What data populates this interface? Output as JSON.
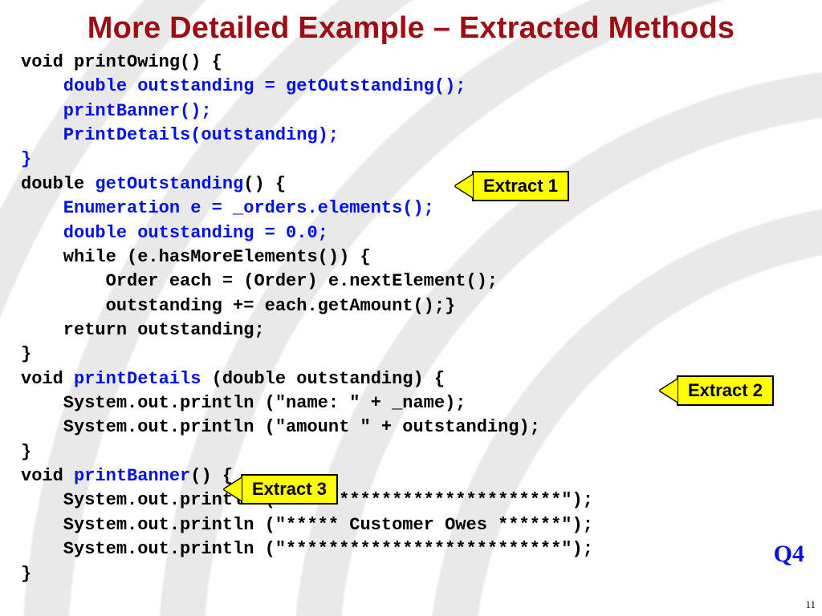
{
  "title": "More Detailed Example – Extracted Methods",
  "code": {
    "l01a": "void printOwing() {",
    "l02": "    double outstanding = getOutstanding();",
    "l03": "    printBanner();",
    "l04": "    PrintDetails(outstanding);",
    "l05": "}",
    "l06a": "double ",
    "l06b": "getOutstanding",
    "l06c": "() {",
    "l07": "    Enumeration e = _orders.elements();",
    "l08": "    double outstanding = 0.0;",
    "l09": "    while (e.hasMoreElements()) {",
    "l10": "        Order each = (Order) e.nextElement();",
    "l11": "        outstanding += each.getAmount();}",
    "l12": "    return outstanding;",
    "l13": "}",
    "l14a": "void ",
    "l14b": "printDetails",
    "l14c": " (double outstanding) {",
    "l15": "    System.out.println (\"name: \" + _name);",
    "l16": "    System.out.println (\"amount \" + outstanding);",
    "l17": "}",
    "l18a": "void ",
    "l18b": "printBanner",
    "l18c": "() {",
    "l19": "    System.out.println (\"**************************\");",
    "l20": "    System.out.println (\"***** Customer Owes ******\");",
    "l21": "    System.out.println (\"**************************\");",
    "l22": "}"
  },
  "callouts": {
    "c1": "Extract 1",
    "c2": "Extract 2",
    "c3": "Extract 3"
  },
  "q": "Q4",
  "page": "11"
}
